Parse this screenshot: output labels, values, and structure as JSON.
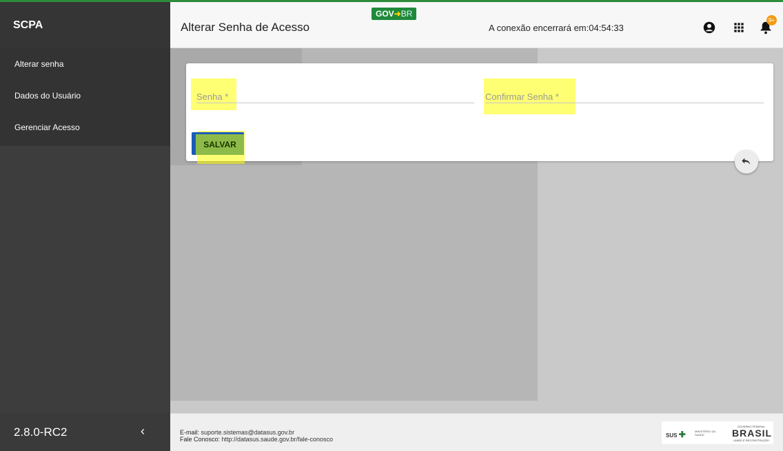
{
  "app": {
    "name": "SCPA",
    "version": "2.8.0-RC2"
  },
  "sidebar": {
    "items": [
      {
        "label": "Alterar senha"
      },
      {
        "label": "Dados do Usuário"
      },
      {
        "label": "Gerenciar Acesso"
      }
    ],
    "collapse_icon": "chevron-left-icon"
  },
  "header": {
    "title": "Alterar Senha de Acesso",
    "gov_logo": {
      "gov": "GOV",
      "arrow": "➜",
      "br": "BR"
    },
    "session_label": "A conexão encerrará em:",
    "session_time": "04:54:33",
    "icons": [
      "account-icon",
      "apps-grid-icon",
      "bell-icon"
    ],
    "notification_badge": "9+"
  },
  "form": {
    "password_label": "Senha *",
    "confirm_label": "Confirmar Senha *",
    "save_label": "SALVAR"
  },
  "footer": {
    "email_label": "E-mail:",
    "email": "suporte.sistemas@datasus.gov.br",
    "contact_label": "Fale Conosco:",
    "contact_url": "http://datasus.saude.gov.br/fale-conosco",
    "logos": {
      "sus": "SUS",
      "ministry": "MINISTÉRIO DA SAÚDE",
      "gov_federal": "GOVERNO FEDERAL",
      "brasil": "BRASIL",
      "brasil_tagline": "UNIÃO E RECONSTRUÇÃO"
    }
  },
  "colors": {
    "accent_green": "#1e8a3a",
    "highlight": "#ffff00",
    "badge": "#f39c12",
    "sidebar": "#3d3d3d"
  }
}
